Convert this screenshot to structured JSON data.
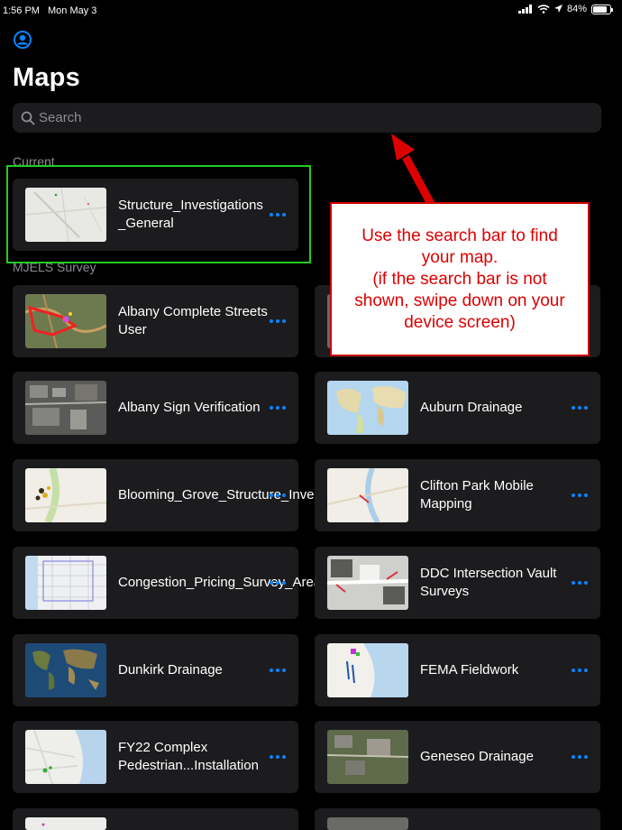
{
  "status": {
    "time": "1:56 PM",
    "date": "Mon May 3",
    "battery": "84%",
    "battery_level": 0.84
  },
  "page": {
    "title": "Maps"
  },
  "search": {
    "placeholder": "Search"
  },
  "sections": {
    "current": "Current",
    "group": "MJELS Survey"
  },
  "current_map": {
    "title": "Structure_Investigations_General",
    "title_line1": "Structure_Investigations",
    "title_line2": "_General"
  },
  "maps": [
    {
      "title": "Albany Complete Streets User"
    },
    {
      "title": ""
    },
    {
      "title": "Albany Sign Verification"
    },
    {
      "title": "Auburn Drainage"
    },
    {
      "title": "Blooming_Grove_Structure_Investigations"
    },
    {
      "title": "Clifton Park Mobile Mapping"
    },
    {
      "title": "Congestion_Pricing_Survey_Areas"
    },
    {
      "title": "DDC Intersection Vault Surveys"
    },
    {
      "title": "Dunkirk Drainage"
    },
    {
      "title": "FEMA Fieldwork"
    },
    {
      "title": "FY22 Complex Pedestrian...Installation"
    },
    {
      "title": "Geneseo Drainage"
    }
  ],
  "annotation": {
    "line1": "Use the search bar to find",
    "line2": "your map.",
    "line3": "(if the search bar is not",
    "line4": "shown, swipe down on your",
    "line5": "device screen)"
  },
  "icons": {
    "profile": "person-circle-icon",
    "search": "magnifier-icon",
    "more": "ellipsis-icon"
  },
  "colors": {
    "accent": "#0a84ff",
    "highlight": "#22cc22",
    "callout_text": "#dd0000"
  }
}
